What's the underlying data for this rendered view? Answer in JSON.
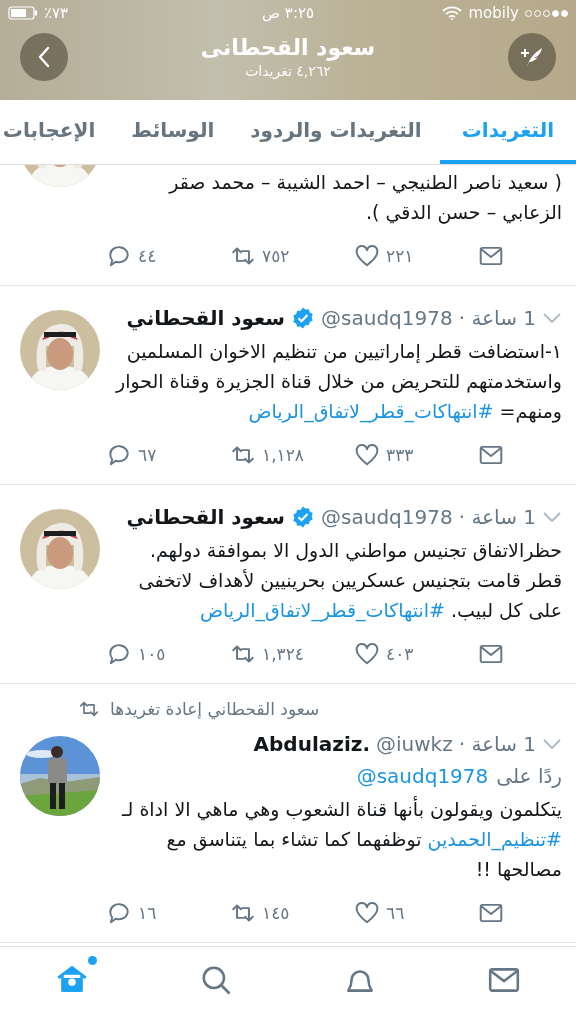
{
  "status_bar": {
    "battery": "٪٧٣",
    "time": "٣:٢٥ ص",
    "carrier": "mobily"
  },
  "header": {
    "title": "سعود القحطانى",
    "subtitle": "٤,٢٦٢ تغريدات"
  },
  "tabs": [
    {
      "label": "التغريدات",
      "selected": true
    },
    {
      "label": "التغريدات والردود",
      "selected": false
    },
    {
      "label": "الوسائط",
      "selected": false
    },
    {
      "label": "الإعجابات",
      "selected": false
    }
  ],
  "tweets": [
    {
      "kind": "partial",
      "text": [
        {
          "kind": "plain",
          "text": "( سعيد ناصر الطنيجي – احمد الشيبة – محمد صقر الزعابي – حسن الدقي )."
        }
      ],
      "replies": "٤٤",
      "retweets": "٧٥٢",
      "likes": "٢٢١"
    },
    {
      "kind": "full",
      "name": "سعود القحطاني",
      "verified": true,
      "handle": "@saudq1978",
      "time": "1 ساعة ·",
      "text": [
        {
          "kind": "plain",
          "text": "١-استضافت قطر إماراتيين من تنظيم الاخوان المسلمين واستخدمتهم للتحريض من خلال قناة الجزيرة وقناة الحوار ومنهم= "
        },
        {
          "kind": "hashtag",
          "text": "#انتهاكات_قطر_لاتفاق_الرياض"
        }
      ],
      "replies": "٦٧",
      "retweets": "١,١٢٨",
      "likes": "٣٣٣"
    },
    {
      "kind": "full",
      "name": "سعود القحطاني",
      "verified": true,
      "handle": "@saudq1978",
      "time": "1 ساعة ·",
      "text": [
        {
          "kind": "plain",
          "text": "حظرالاتفاق تجنيس مواطني الدول الا بموافقة دولهم. قطر قامت بتجنيس  عسكريين بحرينيين لأهداف لاتخفى على كل لبيب. "
        },
        {
          "kind": "hashtag",
          "text": "#انتهاكات_قطر_لاتفاق_الرياض"
        }
      ],
      "replies": "١٠٥",
      "retweets": "١,٣٢٤",
      "likes": "٤٠٣"
    },
    {
      "kind": "full",
      "retweeted_by": "سعود القحطاني إعادة تغريدها",
      "name": "Abdulaziz.",
      "verified": false,
      "handle": "@iuwkz",
      "time": "1 ساعة ·",
      "reply_label": "ردًا على",
      "reply_to": "@saudq1978",
      "text": [
        {
          "kind": "plain",
          "text": "يتكلمون ويقولون بأنها قناة الشعوب وهي ماهي الا اداة لـ "
        },
        {
          "kind": "hashtag",
          "text": "#تنظيم_الحمدين"
        },
        {
          "kind": "plain",
          "text": " توظفهما كما تشاء بما يتناسق مع مصالحها !!"
        }
      ],
      "replies": "١٦",
      "retweets": "١٤٥",
      "likes": "٦٦"
    }
  ],
  "bottom_tabs": [
    {
      "selected": true,
      "unread": true
    },
    {
      "selected": false,
      "unread": false
    },
    {
      "selected": false,
      "unread": false
    },
    {
      "selected": false,
      "unread": false
    }
  ]
}
